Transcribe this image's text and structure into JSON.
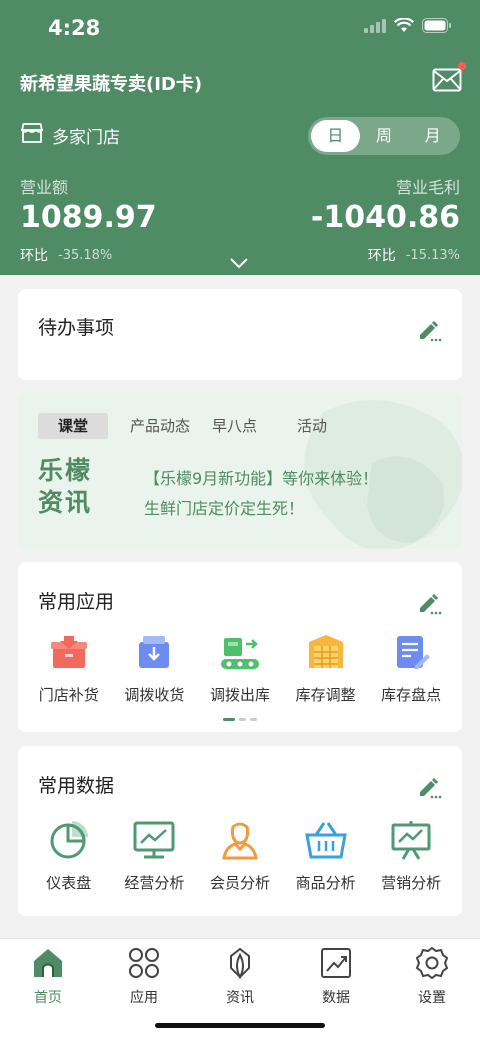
{
  "status_bar": {
    "time": "4:28"
  },
  "header": {
    "store_title": "新希望果蔬专卖(ID卡)",
    "multi_store_label": "多家门店",
    "period_tabs": [
      {
        "label": "日",
        "active": true
      },
      {
        "label": "周",
        "active": false
      },
      {
        "label": "月",
        "active": false
      }
    ],
    "revenue": {
      "label": "营业额",
      "value": "1089.97",
      "ratio_label": "环比",
      "ratio_value": "-35.18%"
    },
    "gross_profit": {
      "label": "营业毛利",
      "value": "-1040.86",
      "ratio_label": "环比",
      "ratio_value": "-15.13%"
    }
  },
  "todo": {
    "title": "待办事项"
  },
  "news": {
    "tabs": [
      {
        "label": "课堂",
        "active": true
      },
      {
        "label": "产品动态",
        "active": false
      },
      {
        "label": "早八点",
        "active": false
      },
      {
        "label": "活动",
        "active": false
      }
    ],
    "logo_line1": "乐檬",
    "logo_line2": "资讯",
    "headline1": "【乐檬9月新功能】等你来体验！",
    "headline2": "生鲜门店定价定生死！"
  },
  "common_apps": {
    "title": "常用应用",
    "items": [
      {
        "label": "门店补货",
        "icon": "store-replenish-icon"
      },
      {
        "label": "调拨收货",
        "icon": "transfer-receive-icon"
      },
      {
        "label": "调拨出库",
        "icon": "transfer-out-icon"
      },
      {
        "label": "库存调整",
        "icon": "inventory-adjust-icon"
      },
      {
        "label": "库存盘点",
        "icon": "inventory-count-icon"
      }
    ]
  },
  "common_data": {
    "title": "常用数据",
    "items": [
      {
        "label": "仪表盘",
        "icon": "pie-chart-icon"
      },
      {
        "label": "经营分析",
        "icon": "monitor-chart-icon"
      },
      {
        "label": "会员分析",
        "icon": "member-icon"
      },
      {
        "label": "商品分析",
        "icon": "basket-icon"
      },
      {
        "label": "营销分析",
        "icon": "presentation-icon"
      }
    ]
  },
  "tabbar": {
    "items": [
      {
        "label": "首页",
        "active": true
      },
      {
        "label": "应用",
        "active": false
      },
      {
        "label": "资讯",
        "active": false
      },
      {
        "label": "数据",
        "active": false
      },
      {
        "label": "设置",
        "active": false
      }
    ]
  },
  "colors": {
    "brand": "#4f8b64",
    "background": "#f2f2f2"
  }
}
